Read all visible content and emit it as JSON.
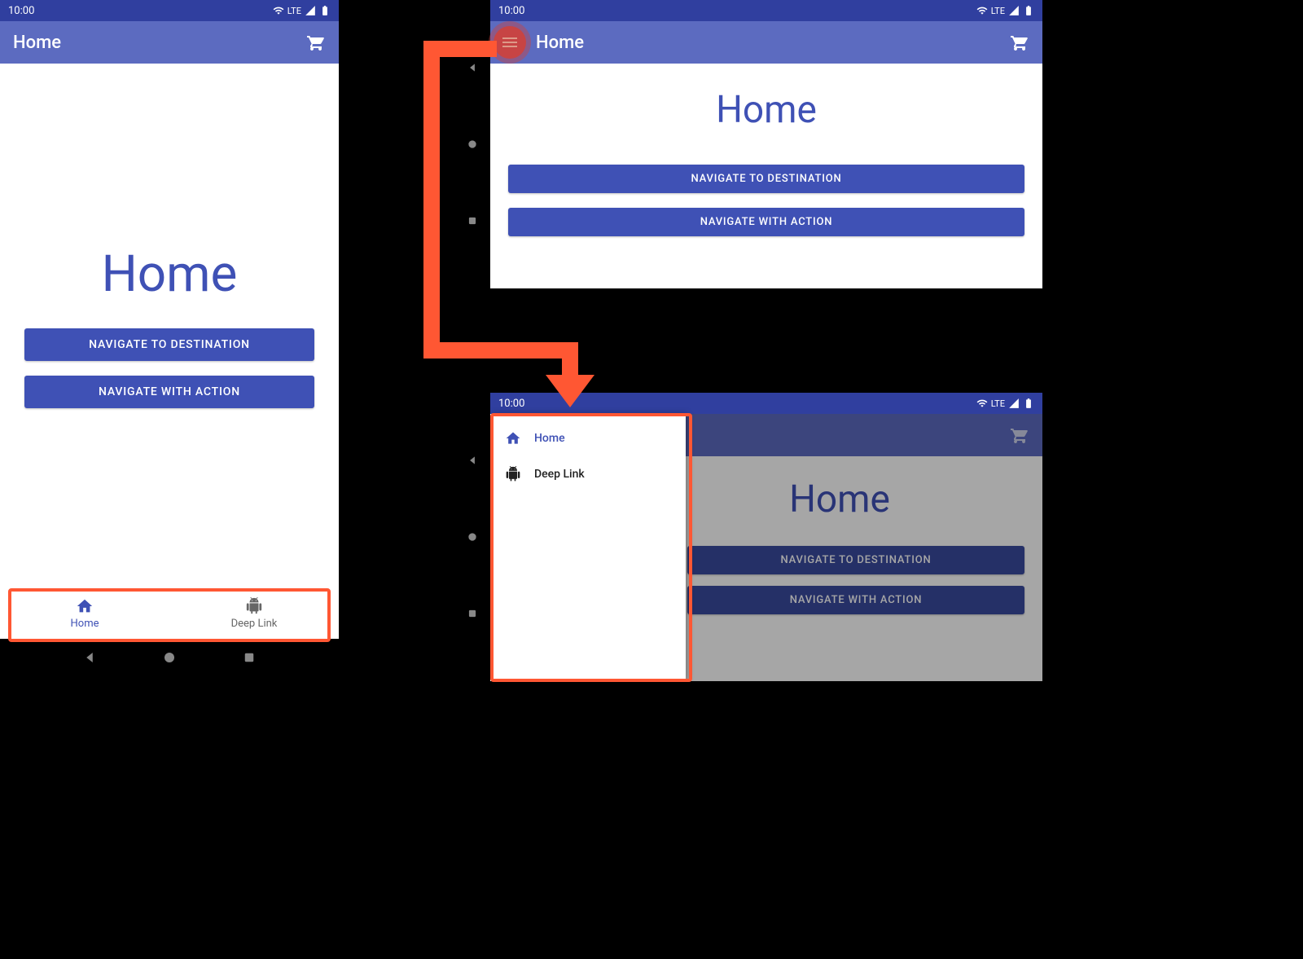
{
  "status": {
    "time": "10:00",
    "network": "LTE"
  },
  "appbar": {
    "title": "Home",
    "action_icon": "cart"
  },
  "hero": {
    "title": "Home"
  },
  "buttons": {
    "nav_dest": "NAVIGATE TO DESTINATION",
    "nav_action": "NAVIGATE WITH ACTION"
  },
  "bottom_nav": {
    "active": "home",
    "items": [
      {
        "id": "home",
        "label": "Home",
        "icon": "home"
      },
      {
        "id": "deeplink",
        "label": "Deep Link",
        "icon": "android"
      }
    ]
  },
  "drawer": {
    "active": "home",
    "items": [
      {
        "id": "home",
        "label": "Home",
        "icon": "home"
      },
      {
        "id": "deeplink",
        "label": "Deep Link",
        "icon": "android"
      }
    ]
  },
  "colors": {
    "primary": "#3f51b5",
    "primary_dark": "#303f9f",
    "highlight": "#ff5733"
  }
}
